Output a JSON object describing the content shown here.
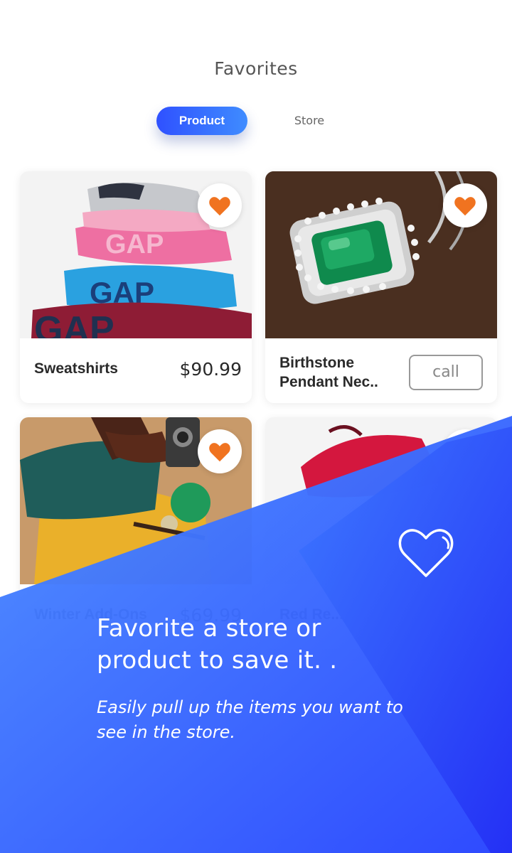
{
  "header": {
    "title": "Favorites"
  },
  "tabs": [
    {
      "label": "Product",
      "active": true
    },
    {
      "label": "Store",
      "active": false
    }
  ],
  "products": [
    {
      "name": "Sweatshirts",
      "price": "$90.99",
      "image": "stacked-sweatshirts",
      "favorited": true
    },
    {
      "name": "Birthstone Pendant Nec..",
      "action": "call",
      "image": "emerald-pendant",
      "favorited": true
    },
    {
      "name": "Winter Add-Ons",
      "price": "$69.99",
      "image": "winter-accessories",
      "favorited": true
    },
    {
      "name": "Red Re...",
      "image": "red-item",
      "favorited": true
    }
  ],
  "promo": {
    "title": "Favorite a store or product to save it. .",
    "subtitle": "Easily pull up the items you want to see in the store.",
    "icon": "heart-outline-icon"
  },
  "colors": {
    "accent_start": "#2f51ff",
    "accent_end": "#3f8cff",
    "heart": "#f07320",
    "overlay_light": "#4a8cff",
    "overlay_dark": "#2a46ff"
  }
}
